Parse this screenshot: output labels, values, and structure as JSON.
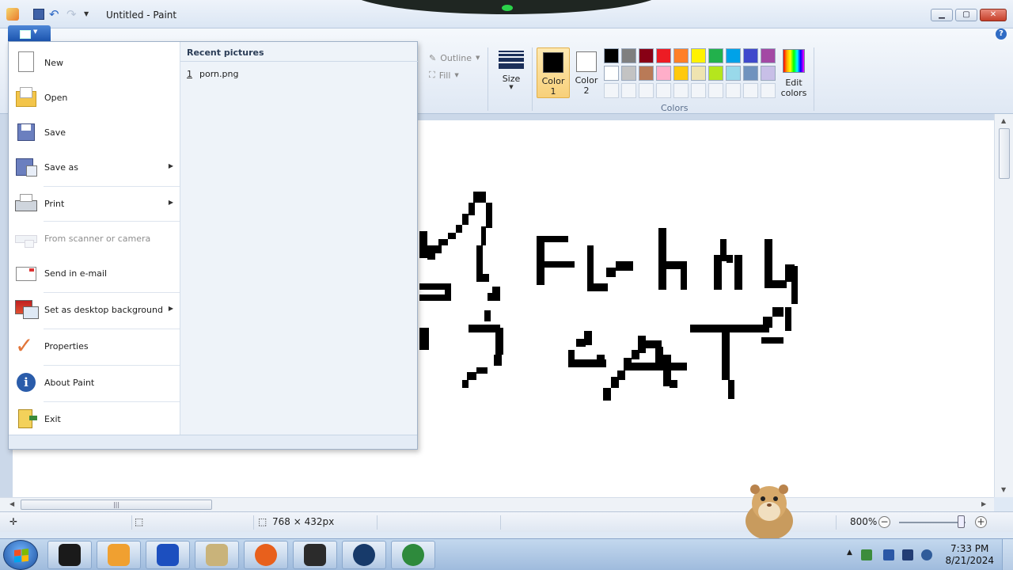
{
  "window": {
    "title": "Untitled - Paint",
    "controls": {
      "minimize": "▭",
      "maximize": "▢",
      "close": "✕"
    }
  },
  "ribbon": {
    "help_icon": "?",
    "outline_label": "Outline",
    "fill_label": "Fill",
    "size_label": "Size",
    "color1_label": "Color",
    "color1_num": "1",
    "color2_label": "Color",
    "color2_num": "2",
    "edit_colors_label": "Edit",
    "edit_colors_label2": "colors",
    "colors_group_label": "Colors",
    "color1_value": "#000000",
    "color2_value": "#ffffff",
    "palette": [
      "#000000",
      "#7f7f7f",
      "#880015",
      "#ed1c24",
      "#ff7f27",
      "#fff200",
      "#22b14c",
      "#00a2e8",
      "#3f48cc",
      "#a349a4",
      "#ffffff",
      "#c3c3c3",
      "#b97a57",
      "#ffaec9",
      "#ffc90e",
      "#efe4b0",
      "#b5e61d",
      "#99d9ea",
      "#7092be",
      "#c8bfe7",
      "",
      "",
      "",
      "",
      "",
      "",
      "",
      "",
      "",
      ""
    ]
  },
  "file_menu": {
    "items": [
      {
        "label": "New",
        "icon": "new-file-icon"
      },
      {
        "label": "Open",
        "icon": "open-folder-icon"
      },
      {
        "label": "Save",
        "icon": "save-disk-icon"
      },
      {
        "label": "Save as",
        "icon": "save-as-icon",
        "submenu": true
      },
      {
        "label": "Print",
        "icon": "printer-icon",
        "submenu": true
      },
      {
        "label": "From scanner or camera",
        "icon": "scanner-icon",
        "disabled": true
      },
      {
        "label": "Send in e-mail",
        "icon": "email-icon"
      },
      {
        "label": "Set as desktop background",
        "icon": "desktop-background-icon",
        "submenu": true
      },
      {
        "label": "Properties",
        "icon": "checkmark-icon"
      },
      {
        "label": "About Paint",
        "icon": "info-icon"
      },
      {
        "label": "Exit",
        "icon": "exit-icon"
      }
    ],
    "recent_title": "Recent pictures",
    "recent_items": [
      {
        "num": "1",
        "name": "porn.png"
      }
    ]
  },
  "statusbar": {
    "image_size": "768 × 432px",
    "zoom": "800%",
    "zoom_out": "−",
    "zoom_in": "+"
  },
  "taskbar": {
    "time": "7:33 PM",
    "date": "8/21/2024",
    "apps": [
      "terminal-icon",
      "media-player-icon",
      "malwarebytes-icon",
      "paint-icon",
      "firefox-icon",
      "screen-icon",
      "steam-icon",
      "globe-download-icon"
    ]
  }
}
